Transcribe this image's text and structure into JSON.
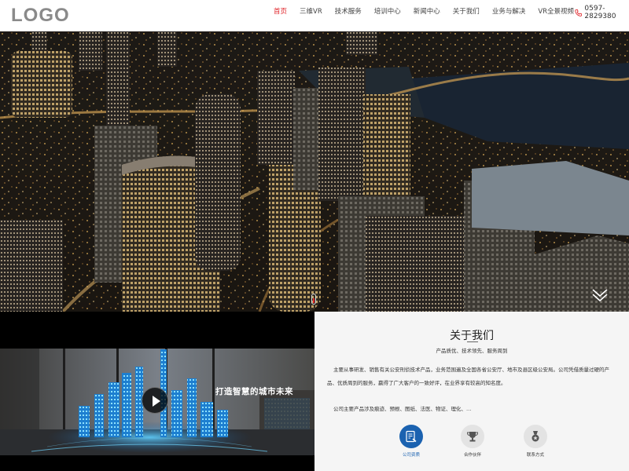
{
  "header": {
    "logo": "LOGO",
    "nav": [
      {
        "label": "首页",
        "active": true
      },
      {
        "label": "三维VR",
        "active": false
      },
      {
        "label": "技术服务",
        "active": false
      },
      {
        "label": "培训中心",
        "active": false
      },
      {
        "label": "新闻中心",
        "active": false
      },
      {
        "label": "关于我们",
        "active": false
      },
      {
        "label": "业务与解决",
        "active": false
      },
      {
        "label": "VR全景视频",
        "active": false
      }
    ],
    "phone": "0597-2829380",
    "phone_icon": "phone-icon"
  },
  "hero": {
    "scroll_icon": "chevron-down-icon",
    "slider_icon": "slider-indicator"
  },
  "video": {
    "title": "打造智慧的城市未来",
    "play_icon": "play-icon"
  },
  "about": {
    "title": "关于我们",
    "subtitle": "产品质优、技术领先、服务周到",
    "paragraph1": "主要从事研发、销售有关公安刑侦技术产品，业务范围遍及全国各省公安厅、地市及县区级公安局。公司凭借质量过硬的产品、优质周到的服务，赢得了广大客户的一致好评，在业界享有较高的知名度。",
    "paragraph2": "公司主要产品涉及痕迹、预根、图纸、法医、物证、理化、…",
    "icons": [
      {
        "label": "公司资质",
        "icon": "certificate-icon"
      },
      {
        "label": "合作伙伴",
        "icon": "trophy-icon"
      },
      {
        "label": "联系方式",
        "icon": "medal-icon"
      }
    ],
    "colors": {
      "accent": "#1b62b0",
      "active_nav": "#e0262b"
    }
  }
}
